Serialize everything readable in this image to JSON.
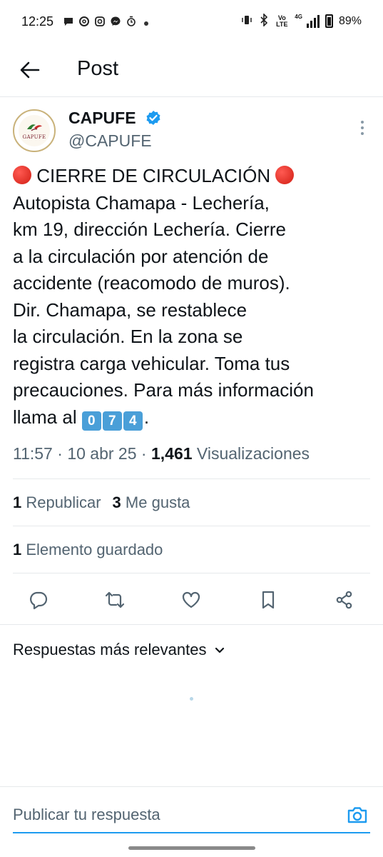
{
  "status_bar": {
    "time": "12:25",
    "battery": "89%",
    "volte": "Vo LTE",
    "network": "4G",
    "notification_icons": [
      "chat-bubble-icon",
      "threads-icon",
      "instagram-icon",
      "messenger-icon",
      "alarm-icon"
    ],
    "system_icons": [
      "vibrate-icon",
      "bluetooth-icon",
      "volte-icon",
      "signal-icon",
      "battery-icon"
    ]
  },
  "header": {
    "title": "Post"
  },
  "author": {
    "name": "CAPUFE",
    "handle": "@CAPUFE",
    "avatar_text": "GAPUFE",
    "verified": true
  },
  "tweet": {
    "lines": [
      " CIERRE DE CIRCULACIÓN ",
      "Autopista Chamapa - Lechería,",
      "km 19, dirección Lechería. Cierre",
      "a la circulación por atención de",
      "accidente (reacomodo de muros).",
      "Dir. Chamapa, se restablece",
      "la circulación. En la zona se",
      "registra carga vehicular. Toma tus",
      "precauciones. Para más información",
      "llama al "
    ],
    "phone_digits": [
      "0",
      "7",
      "4"
    ],
    "phone_suffix": ".",
    "time": "11:57",
    "date": "10 abr 25",
    "views_count": "1,461",
    "views_label": "Visualizaciones",
    "separator": " · "
  },
  "stats": {
    "reposts_count": "1",
    "reposts_label": "Republicar",
    "likes_count": "3",
    "likes_label": "Me gusta",
    "bookmarks_count": "1",
    "bookmarks_label": "Elemento guardado"
  },
  "actions": [
    "reply-icon",
    "repost-icon",
    "like-icon",
    "bookmark-icon",
    "share-icon"
  ],
  "replies": {
    "sort_label": "Respuestas más relevantes"
  },
  "composer": {
    "placeholder": "Publicar tu respuesta"
  },
  "colors": {
    "accent": "#1d9bf0",
    "text_primary": "#0f1419",
    "text_secondary": "#536471",
    "divider": "#e6e9eb",
    "red_circle": "#d11e14",
    "keycap": "#4a9fd8"
  }
}
